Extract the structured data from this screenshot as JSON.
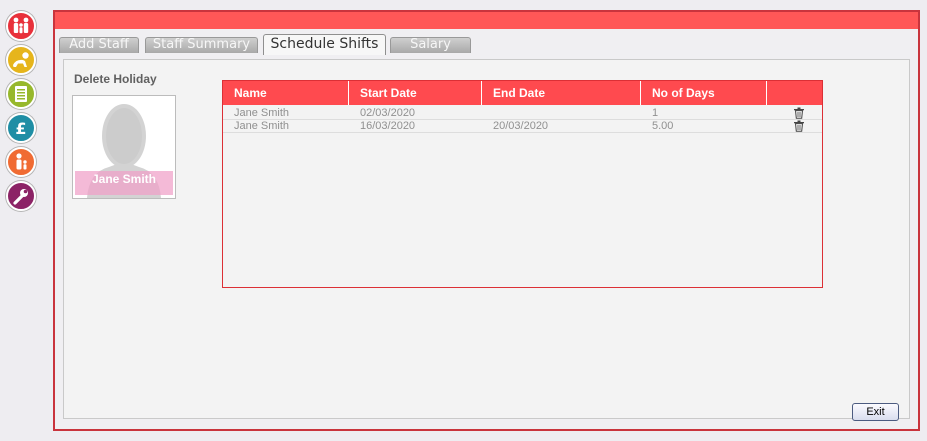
{
  "sidebar": {
    "items": [
      {
        "icon": "family-icon",
        "color": "#e8313b"
      },
      {
        "icon": "baby-crawl-icon",
        "color": "#e6b51c"
      },
      {
        "icon": "register-list-icon",
        "color": "#97b82c"
      },
      {
        "icon": "pound-icon",
        "color": "#1f8ea5"
      },
      {
        "icon": "staff-person-icon",
        "color": "#f06b33"
      },
      {
        "icon": "wrench-icon",
        "color": "#8c2366"
      }
    ]
  },
  "colors": {
    "header": "#ff5757",
    "grid_header": "#ff4a4f",
    "frame_border": "#c9343d"
  },
  "tabs": [
    {
      "label": "Add Staff",
      "active": false
    },
    {
      "label": "Staff Summary",
      "active": false
    },
    {
      "label": "Schedule Shifts",
      "active": true
    },
    {
      "label": "Salary",
      "active": false
    }
  ],
  "panel": {
    "title": "Delete Holiday",
    "staff_name": "Jane Smith"
  },
  "table": {
    "columns": [
      "Name",
      "Start Date",
      "End Date",
      "No of Days",
      ""
    ],
    "rows": [
      {
        "name": "Jane Smith",
        "start": "02/03/2020",
        "end": "",
        "days": "1"
      },
      {
        "name": "Jane Smith",
        "start": "16/03/2020",
        "end": "20/03/2020",
        "days": "5.00"
      }
    ]
  },
  "buttons": {
    "exit": "Exit"
  }
}
